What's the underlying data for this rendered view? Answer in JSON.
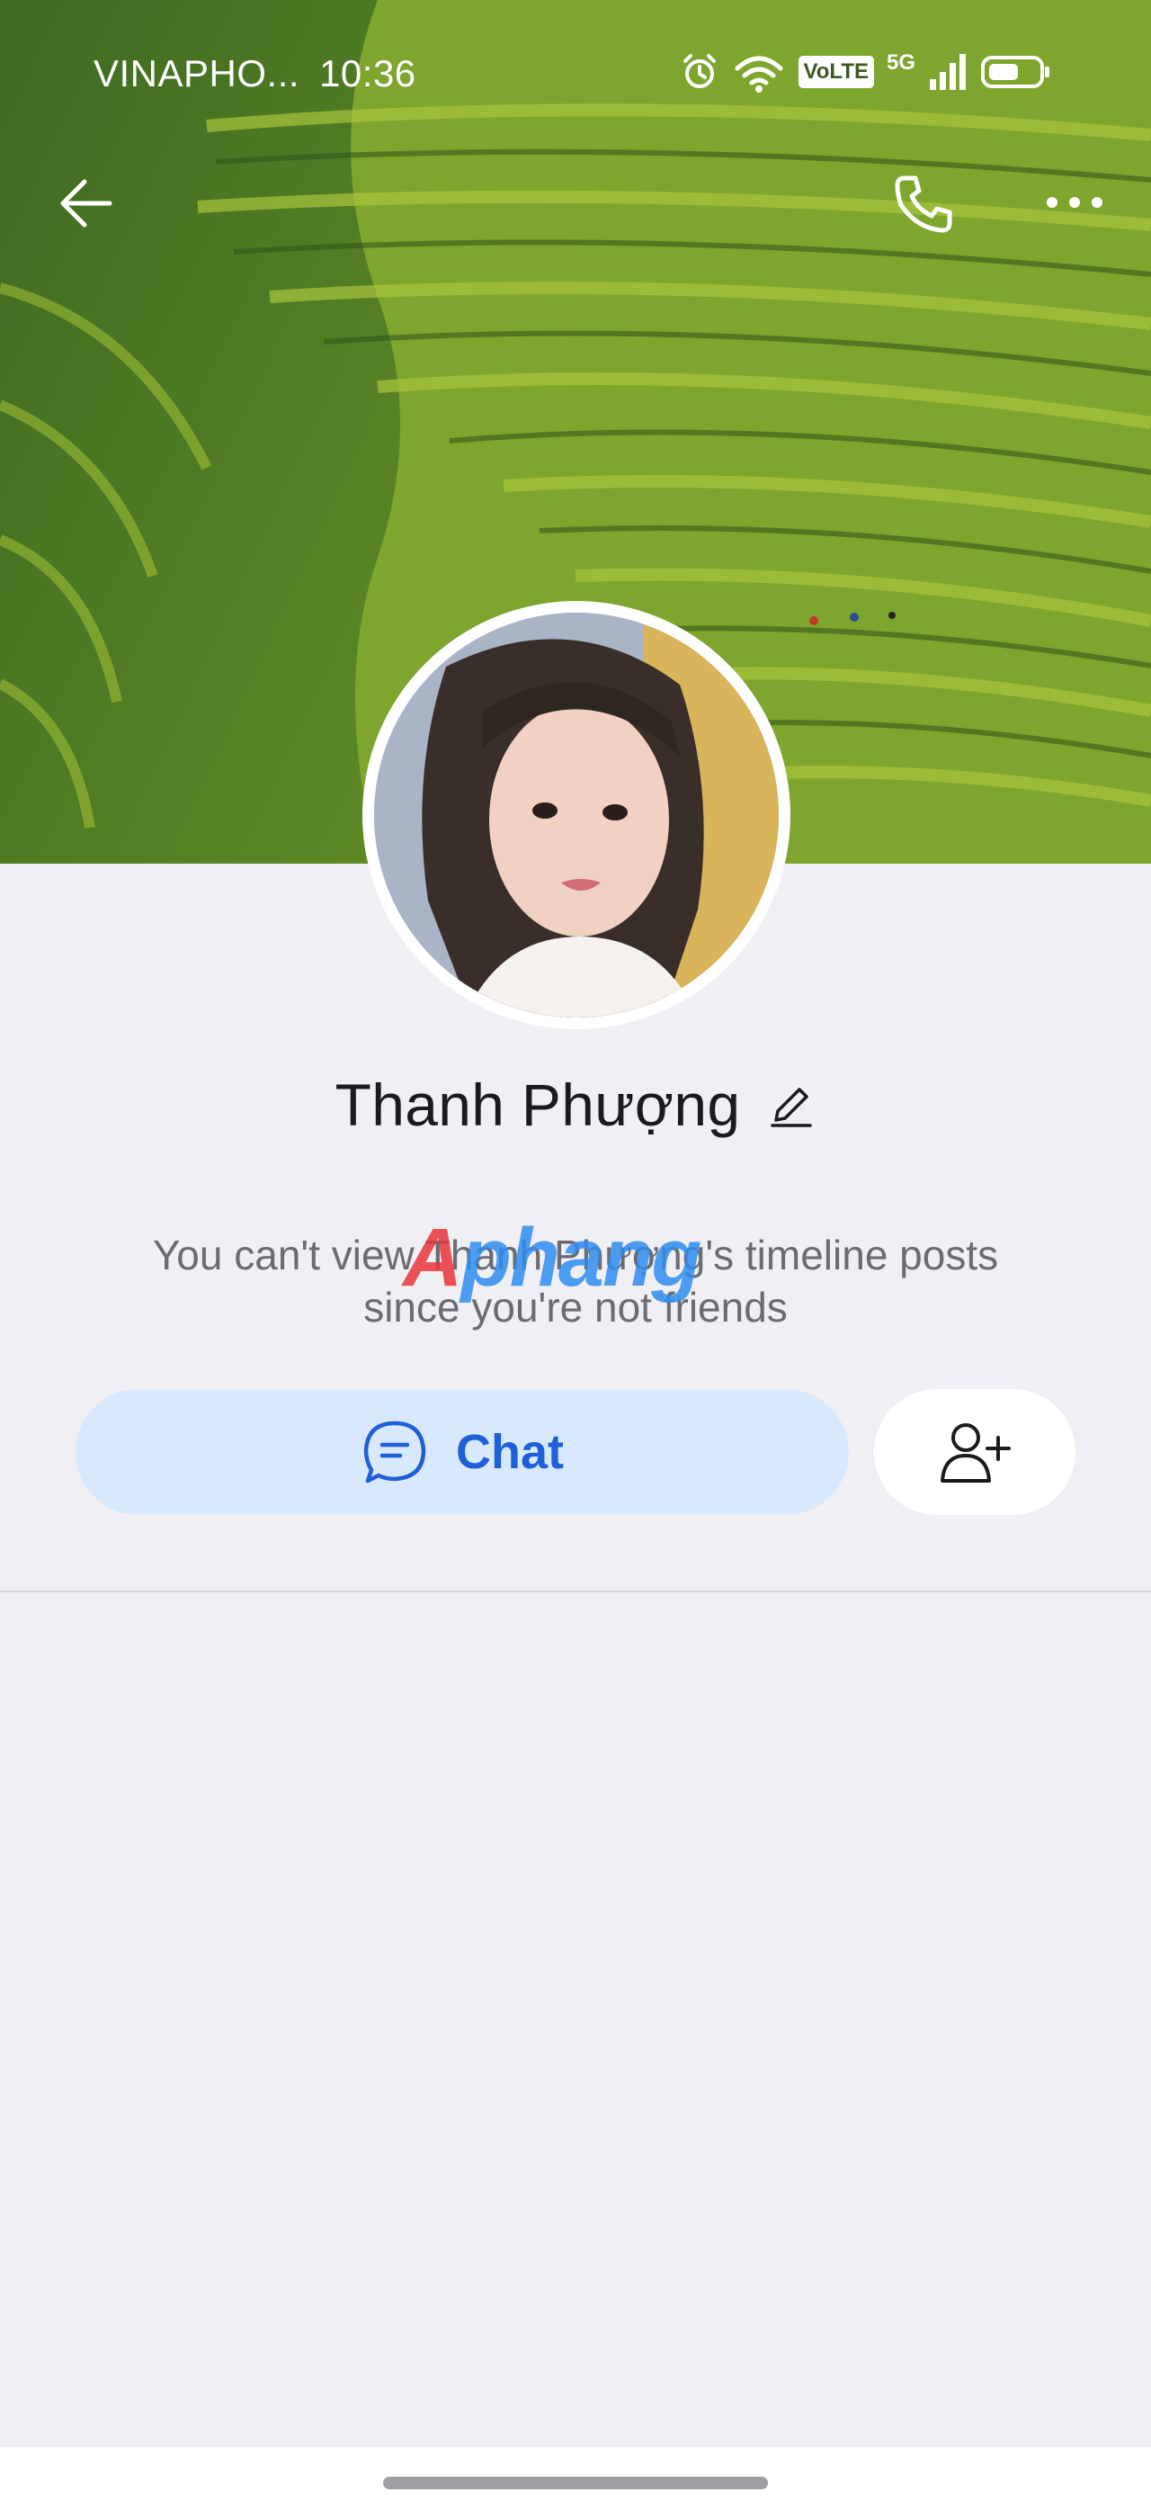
{
  "status_bar": {
    "carrier": "VINAPHO...",
    "time": "10:36",
    "volte_badge": "VoLTE",
    "network": "5G",
    "icons": [
      "alarm-icon",
      "wifi-icon",
      "signal-icon",
      "battery-icon"
    ]
  },
  "nav": {
    "back_icon": "arrow-left-icon",
    "call_icon": "phone-icon",
    "more_icon": "more-horizontal-icon"
  },
  "profile": {
    "name": "Thanh Phượng",
    "edit_icon": "pencil-icon",
    "notice_line1": "You can't view Thanh Phượng's timeline posts",
    "notice_line2": "since you're not friends"
  },
  "watermark": {
    "text_a": "A",
    "text_rest": "phang"
  },
  "actions": {
    "chat_label": "Chat",
    "chat_icon": "chat-bubble-icon",
    "add_friend_icon": "add-user-icon"
  },
  "colors": {
    "accent": "#1f5fd8",
    "chat_bg": "#d9e9fd",
    "page_bg": "#f0eff4"
  }
}
